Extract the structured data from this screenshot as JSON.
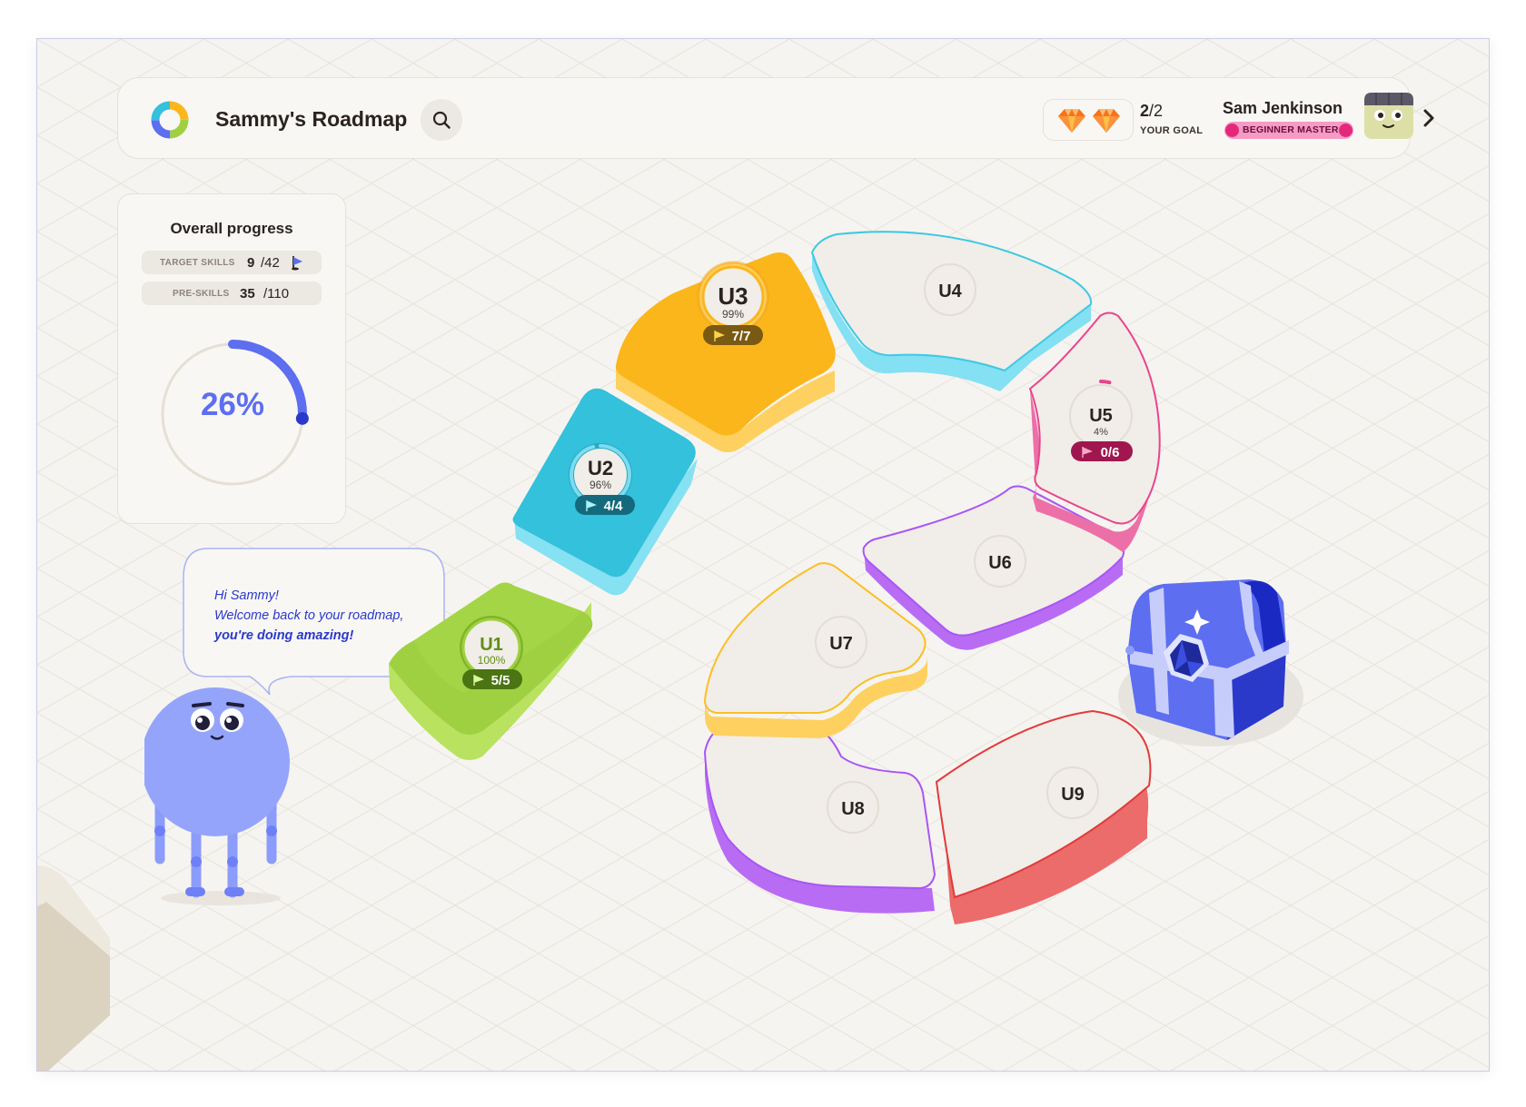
{
  "header": {
    "title": "Sammy's Roadmap",
    "goal_count": "2",
    "goal_total": "/2",
    "goal_label": "YOUR GOAL",
    "user_name": "Sam Jenkinson",
    "rank": "BEGINNER MASTER"
  },
  "progress": {
    "title": "Overall progress",
    "target_skills": {
      "label": "TARGET SKILLS",
      "value": "9",
      "total": "/42"
    },
    "pre_skills": {
      "label": "PRE-SKILLS",
      "value": "35",
      "total": "/110"
    },
    "percent_text": "26%",
    "percent_value": 0.26
  },
  "greeting": {
    "line1": "Hi Sammy!",
    "line2": "Welcome back to your roadmap,",
    "line3": "you're doing amazing!"
  },
  "units": [
    {
      "name": "U1",
      "percent": "100%",
      "skills": "5/5",
      "color": "#9fd041"
    },
    {
      "name": "U2",
      "percent": "96%",
      "skills": "4/4",
      "color": "#33c1dc"
    },
    {
      "name": "U3",
      "percent": "99%",
      "skills": "7/7",
      "color": "#fbb61c"
    },
    {
      "name": "U4",
      "color": "#3ec9e3"
    },
    {
      "name": "U5",
      "percent": "4%",
      "skills": "0/6",
      "color": "#e9448d"
    },
    {
      "name": "U6",
      "color": "#a855f7"
    },
    {
      "name": "U7",
      "color": "#fbbf24"
    },
    {
      "name": "U8",
      "color": "#a855f7"
    },
    {
      "name": "U9",
      "color": "#e23a3a"
    }
  ],
  "colors": {
    "accent": "#5d6ef0",
    "background": "#f6f4f0",
    "text": "#2b2320"
  }
}
